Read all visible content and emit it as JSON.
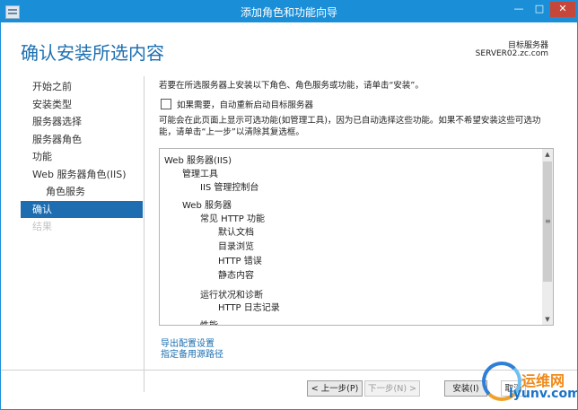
{
  "window": {
    "title": "添加角色和功能向导",
    "controls": {
      "minimize": "—",
      "maximize": "□",
      "close": "✕"
    }
  },
  "header": {
    "page_title": "确认安装所选内容",
    "target_label": "目标服务器",
    "target_server": "SERVER02.zc.com"
  },
  "nav": {
    "items": [
      {
        "label": "开始之前"
      },
      {
        "label": "安装类型"
      },
      {
        "label": "服务器选择"
      },
      {
        "label": "服务器角色"
      },
      {
        "label": "功能"
      },
      {
        "label": "Web 服务器角色(IIS)"
      },
      {
        "label": "角色服务"
      },
      {
        "label": "确认"
      },
      {
        "label": "结果"
      }
    ]
  },
  "main": {
    "intro": "若要在所选服务器上安装以下角色、角色服务或功能，请单击“安装”。",
    "restart_label": "如果需要，自动重新启动目标服务器",
    "note": "可能会在此页面上显示可选功能(如管理工具)，因为已自动选择这些功能。如果不希望安装这些可选功能，请单击“上一步”以清除其复选框。",
    "features": [
      "Web 服务器(IIS)",
      "管理工具",
      "IIS 管理控制台",
      "Web 服务器",
      "常见 HTTP 功能",
      "默认文档",
      "目录浏览",
      "HTTP 错误",
      "静态内容",
      "运行状况和诊断",
      "HTTP 日志记录",
      "性能"
    ],
    "export_link": "导出配置设置",
    "alt_source_link": "指定备用源路径"
  },
  "scrollbar": {
    "up": "▲",
    "down": "▼",
    "grip": "≡"
  },
  "buttons": {
    "prev": "< 上一步(P)",
    "next": "下一步(N) >",
    "install": "安装(I)",
    "cancel": "取消"
  },
  "watermark": {
    "line1": "运维网",
    "line2": "iyunv.com"
  },
  "colors": {
    "accent": "#1a8fd8",
    "nav_active": "#1d6db0",
    "title_text": "#1c6fb1",
    "close_button": "#c7463a"
  }
}
